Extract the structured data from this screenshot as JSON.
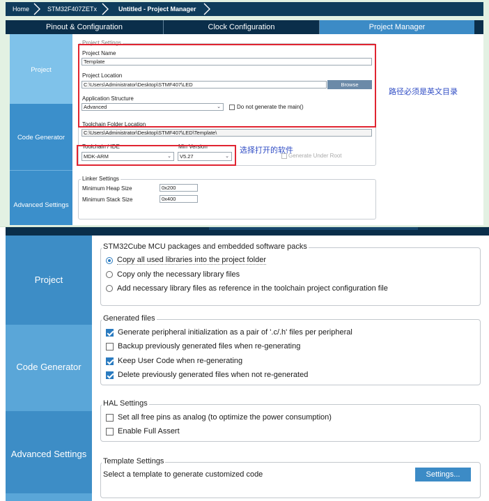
{
  "top": {
    "breadcrumb": [
      "Home",
      "STM32F407ZETx",
      "Untitled - Project Manager"
    ],
    "tabs": [
      "Pinout & Configuration",
      "Clock Configuration",
      "Project Manager"
    ],
    "sidebar": [
      "Project",
      "Code Generator",
      "Advanced Settings"
    ],
    "project_settings": {
      "group_title": "Project Settings",
      "name_label": "Project Name",
      "name_value": "Template",
      "location_label": "Project Location",
      "location_value": "C:\\Users\\Administrator\\Desktop\\STMF407\\LED",
      "browse_label": "Browse",
      "structure_label": "Application Structure",
      "structure_value": "Advanced",
      "no_main_label": "Do not generate the main()",
      "toolchain_folder_label": "Toolchain Folder Location",
      "toolchain_folder_value": "C:\\Users\\Administrator\\Desktop\\STMF407\\LED\\Template\\",
      "toolchain_label": "Toolchain / IDE",
      "toolchain_value": "MDK-ARM",
      "min_version_label": "Min Version",
      "min_version_value": "V5.27",
      "generate_under_root_label": "Generate Under Root"
    },
    "linker": {
      "group_title": "Linker Settings",
      "heap_label": "Minimum Heap Size",
      "heap_value": "0x200",
      "stack_label": "Minimum Stack Size",
      "stack_value": "0x400"
    },
    "annotations": {
      "path_note": "路径必须是英文目录",
      "toolchain_note": "选择打开的软件"
    }
  },
  "bottom": {
    "sidebar": [
      "Project",
      "Code Generator",
      "Advanced Settings"
    ],
    "packs": {
      "title": "STM32Cube MCU packages and embedded software packs",
      "options": [
        "Copy all used libraries into the project folder",
        "Copy only the necessary library files",
        "Add necessary library files as reference in the toolchain project configuration file"
      ],
      "selected": 0
    },
    "generated": {
      "title": "Generated files",
      "options": [
        {
          "label": "Generate peripheral initialization as a pair of '.c/.h' files per peripheral",
          "checked": true
        },
        {
          "label": "Backup previously generated files when re-generating",
          "checked": false
        },
        {
          "label": "Keep User Code when re-generating",
          "checked": true
        },
        {
          "label": "Delete previously generated files when not re-generated",
          "checked": true
        }
      ]
    },
    "hal": {
      "title": "HAL Settings",
      "options": [
        {
          "label": "Set all free pins as analog (to optimize the power consumption)",
          "checked": false
        },
        {
          "label": "Enable Full Assert",
          "checked": false
        }
      ]
    },
    "template": {
      "title": "Template Settings",
      "text": "Select a template to generate customized code",
      "button": "Settings..."
    }
  }
}
